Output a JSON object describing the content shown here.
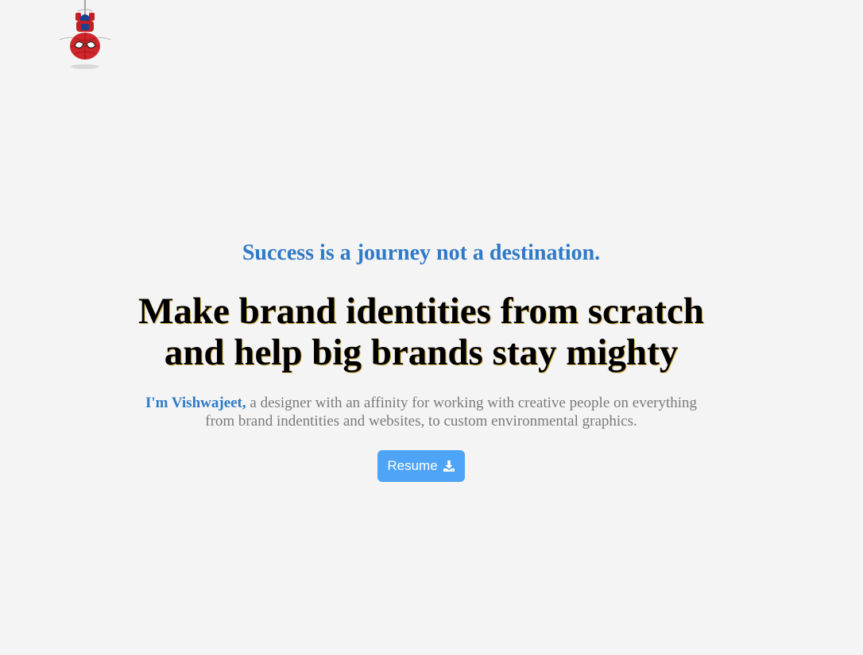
{
  "logo": {
    "icon": "spider-mascot-icon"
  },
  "hero": {
    "tagline": "Success is a journey not a destination.",
    "headline_line1": "Make brand identities from scratch",
    "headline_line2": "and help big brands stay mighty",
    "intro_name": "I'm Vishwajeet,",
    "intro_text": " a designer with an affinity for working with creative people on everything from brand indentities and websites, to custom environmental graphics."
  },
  "resume_button": {
    "label": "Resume",
    "icon": "download-icon"
  },
  "colors": {
    "background": "#f4f4f4",
    "accent": "#2f7ac7",
    "button": "#4ea5f8",
    "body_text": "#7a7a7a"
  }
}
